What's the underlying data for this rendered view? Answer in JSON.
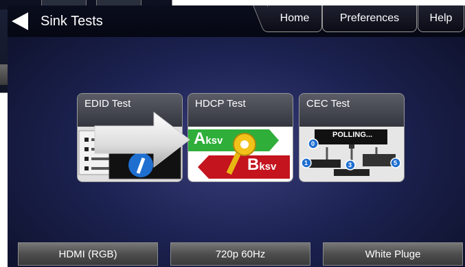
{
  "header": {
    "title": "Sink Tests",
    "tabs": {
      "home": "Home",
      "preferences": "Preferences",
      "help": "Help"
    }
  },
  "tiles": [
    {
      "label": "EDID Test"
    },
    {
      "label": "HDCP Test",
      "aksv_letter": "A",
      "aksv_sub": "ksv",
      "bksv_letter": "B",
      "bksv_sub": "ksv"
    },
    {
      "label": "CEC Test",
      "polling": "POLLING...",
      "nodes": [
        "0",
        "1",
        "3",
        "5"
      ]
    }
  ],
  "bottom": {
    "interface": "HDMI (RGB)",
    "format": "720p 60Hz",
    "pattern": "White Pluge"
  },
  "colors": {
    "accent_green": "#2fae3a",
    "accent_red": "#c4141e",
    "node_blue": "#1f6fd0"
  }
}
